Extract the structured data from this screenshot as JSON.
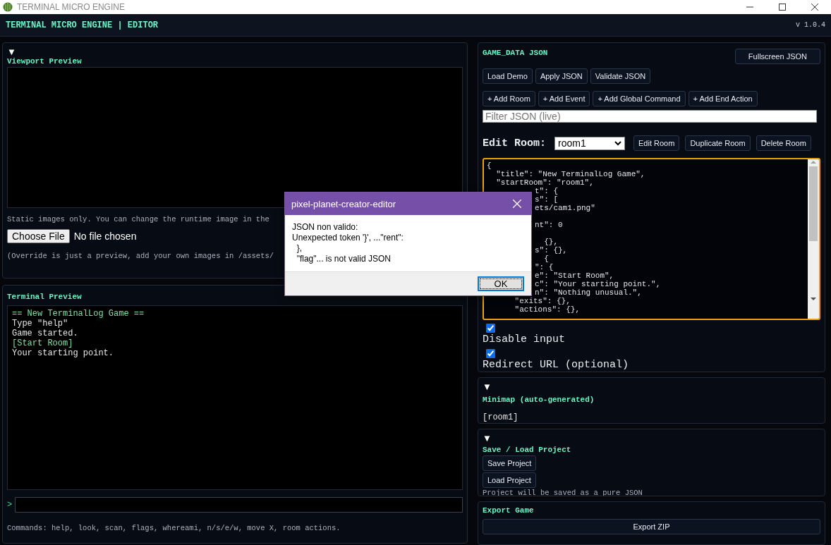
{
  "window": {
    "title": "TERMINAL MICRO ENGINE"
  },
  "header": {
    "title": "TERMINAL MICRO ENGINE | EDITOR",
    "version": "v 1.0.4"
  },
  "viewport_panel": {
    "toggle": "▼",
    "title": "Viewport Preview",
    "note": "Static images only. You can change the runtime image in the",
    "file_button": "Choose File",
    "file_status": "No file chosen",
    "hint": "(Override is just a preview, add your own images in /assets/"
  },
  "terminal_panel": {
    "title": "Terminal Preview",
    "lines": [
      {
        "text": "== New TerminalLog Game ==",
        "kind": "accent"
      },
      {
        "text": "Type \"help\"",
        "kind": "plain"
      },
      {
        "text": "Game started.",
        "kind": "plain"
      },
      {
        "text": "[Start Room]",
        "kind": "accent"
      },
      {
        "text": "Your starting point.",
        "kind": "plain"
      }
    ],
    "prompt": ">",
    "commands": "Commands: help, look, scan, flags, whereami, n/s/e/w, move X, room actions."
  },
  "json_panel": {
    "title": "GAME_DATA JSON",
    "fullscreen_button": "Fullscreen JSON",
    "buttons": [
      "Load Demo",
      "Apply JSON",
      "Validate JSON"
    ],
    "add_buttons": [
      "+ Add Room",
      "+ Add Event",
      "+ Add Global Command",
      "+ Add End Action"
    ],
    "filter": {
      "placeholder": "Filter JSON (live)"
    },
    "edit_room": {
      "label": "Edit Room:",
      "value": "room1",
      "buttons": [
        "Edit Room",
        "Duplicate Room",
        "Delete Room"
      ]
    },
    "editor_lines": [
      {
        "text": "{",
        "kind": "full"
      },
      {
        "text": "  \"title\": \"New TerminalLog Game\",",
        "kind": "full"
      },
      {
        "text": "  \"startRoom\": \"room1\",",
        "kind": "full"
      },
      {
        "text": "t\": {",
        "kind": "clipped"
      },
      {
        "text": "s\": [",
        "kind": "clipped"
      },
      {
        "text": "ets/cam1.png\"",
        "kind": "clipped"
      },
      {
        "text": "nt\": 0",
        "kind": "clipped_after_blank"
      },
      {
        "text": "  {},",
        "kind": "clipped_after_blank"
      },
      {
        "text": "s\": {},",
        "kind": "clipped"
      },
      {
        "text": "  {",
        "kind": "clipped"
      },
      {
        "text": "\": {",
        "kind": "clipped"
      },
      {
        "text": "e\": \"Start Room\",",
        "kind": "clipped"
      },
      {
        "text": "c\": \"Your starting point.\",",
        "kind": "clipped"
      },
      {
        "text": "n\": \"Nothing unusual.\",",
        "kind": "clipped"
      },
      {
        "text": "      \"exits\": {},",
        "kind": "full"
      },
      {
        "text": "      \"actions\": {},",
        "kind": "full"
      }
    ],
    "options": [
      {
        "label": "Disable input",
        "checked": true
      },
      {
        "label": "Redirect URL (optional)",
        "checked": true
      }
    ]
  },
  "minimap_panel": {
    "toggle": "▼",
    "title": "Minimap (auto-generated)",
    "content": "[room1]"
  },
  "project_panel": {
    "toggle": "▼",
    "title": "Save / Load Project",
    "buttons": [
      "Save Project",
      "Load Project"
    ],
    "note": "Project will be saved as a pure JSON"
  },
  "export_panel": {
    "title": "Export Game",
    "button": "Export ZIP"
  },
  "dialog": {
    "title": "pixel-planet-creator-editor",
    "message": [
      "JSON non valido:",
      "Unexpected token '}', ...\"rent\":",
      "  },",
      "  \"flag\"... is not valid JSON"
    ],
    "button": "OK"
  }
}
